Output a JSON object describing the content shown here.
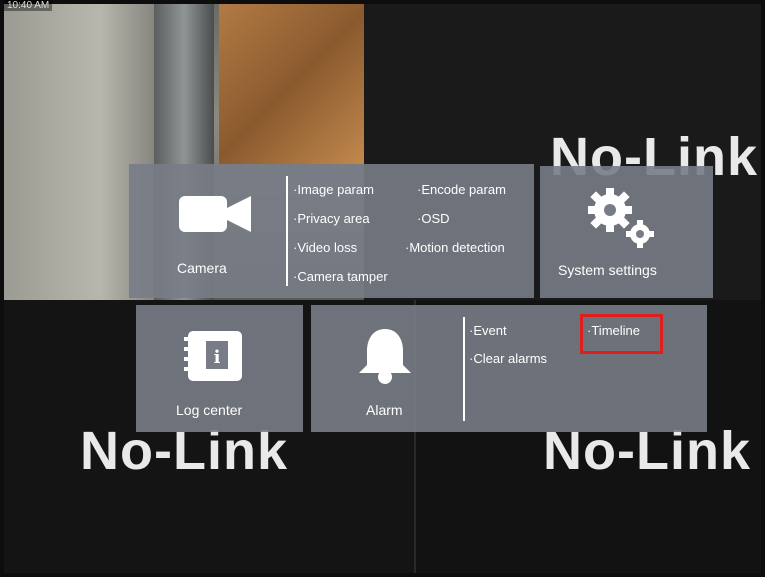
{
  "overlay": {
    "timestamp": "10:40 AM"
  },
  "channels": {
    "no_link_text": "No-Link"
  },
  "camera": {
    "label": "Camera",
    "items": [
      "Image param",
      "Encode param",
      "Privacy area",
      "OSD",
      "Video loss",
      "Motion detection",
      "Camera tamper"
    ]
  },
  "system": {
    "label": "System settings"
  },
  "log": {
    "label": "Log center"
  },
  "alarm": {
    "label": "Alarm",
    "items": [
      "Event",
      "Timeline",
      "Clear alarms"
    ]
  },
  "colors": {
    "tile_bg": "#787c86",
    "highlight": "#e01e1e"
  },
  "icons": [
    "video-camera-icon",
    "gears-icon",
    "notebook-icon",
    "bell-icon"
  ]
}
